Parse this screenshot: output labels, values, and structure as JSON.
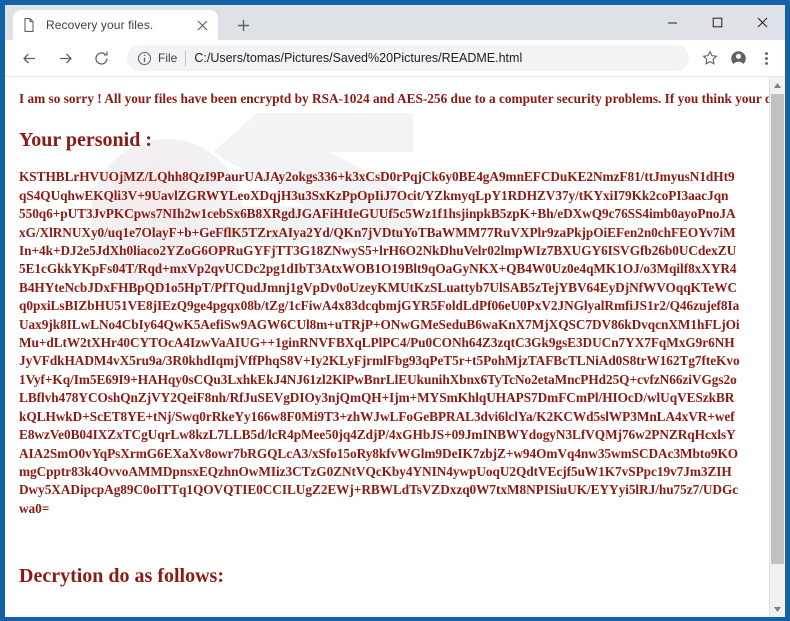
{
  "browser": {
    "tab": {
      "title": "Recovery your files.",
      "favicon_icon": "page-icon",
      "close_icon": "close-icon"
    },
    "new_tab_icon": "plus-icon",
    "window_controls": {
      "minimize_icon": "minimize-icon",
      "maximize_icon": "maximize-icon",
      "close_icon": "close-icon"
    },
    "toolbar": {
      "back_icon": "back-arrow-icon",
      "forward_icon": "forward-arrow-icon",
      "reload_icon": "reload-icon",
      "info_icon": "info-circle-icon",
      "scheme_label": "File",
      "url": "C:/Users/tomas/Pictures/Saved%20Pictures/README.html",
      "bookmark_icon": "star-icon",
      "profile_icon": "account-avatar-icon",
      "menu_icon": "three-dots-menu-icon"
    },
    "scrollbar": {
      "up_arrow_icon": "scroll-up-arrow-icon",
      "down_arrow_icon": "scroll-down-arrow-icon"
    }
  },
  "colors": {
    "window_frame": "#1461a6",
    "tabstrip": "#dee1e6",
    "ransom_text": "#8b1a12",
    "scrollbar_thumb": "#c1c1c1"
  },
  "page": {
    "intro_lines": "I am so sorry ! All your files have been encryptd by RSA-1024 and AES-256 due to a computer security problems.\nIf you think your data is very important .The only way to decrypt your file is to buy my decrytion tool .\nelse you can delete your encrypted data or reinstall your system.",
    "personid_heading": "Your personid :",
    "personid_key": "KSTHBLrHVUOjMZ/LQhh8QzI9PaurUAJAy2okgs336+k3xCsD0rPqjCk6y0BE4gA9mnEFCDuKE2NmzF81/ttJmyusN1dHt9\nqS4QUqhwEKQli3V+9UavlZGRWYLeoXDqjH3u3SxKzPpOpIiJ7Ocit/YZkmyqLpY1RDHZV37y/tKYxiI79Kk2coPI3aacJqn\n550q6+pUT3JvPKCpws7NIh2w1cebSx6B8XRgdJGAFiHtIeGUUf5c5Wz1f1hsjinpkB5zpK+Bh/eDXwQ9c76SS4imb0ayoPnoJA\nxG/XlRNUXy0/uq1e7OlayF+b+GeFflK5TZrxAIya2Yd/QKn7jVDtuYoTBaWMM77RuVXPlr9zaPkjpOiEFen2n0chFEOYv7iM\nIn+4k+DJ2e5JdXh0liaco2YZoG6OPRuGYFjTT3G18ZNwyS5+lrH6O2NkDhuVelr02lmpWIz7BXUGY6ISVGfb26b0UCdexZU\n5E1cGkkYKpFs04T/Rqd+mxVp2qvUCDc2pg1dIbT3AtxWOB1O19Blt9qOaGyNKX+QB4W0Uz0e4qMK1OJ/o3Mqilf8xXYR4\nB4HYteNcbJDxFHBpQD1o5HpT/PfTQudJmnj1gVpDv0oUzeyKMUtKzSLuattyb7UlSAB5zTejYBV64EyDjNfWVOqqKTeWC\nq0pxiLsBIZbHU51VE8jIEzQ9ge4pgqx08b/tZg/1cFiwA4x83dcqbmjGYR5FoldLdPf06eU0PxV2JNGlyalRmfiJS1r2/Q46zujef8Ia\nUax9jk8ILwLNo4CbIy64QwK5AefiSw9AGW6CUl8m+uTRjP+ONwGMeSeduB6waKnX7MjXQSC7DV86kDvqcnXM1hFLjOi\nMu+dLtW2tXHr40CYTOcA4IzwVaAIUG++1ginRNVFBXqLPlPC4/Pu0CONh64Z3zqtC3Gk9gsE3DUCn7YX7FqMxG9r6NH\nJyVFdkHADM4vX5ru9a/3R0khdIqmjVffPhqS8V+Iy2KLyFjrmlFbg93qPeT5r+t5PohMjzTAFBcTLNiAd0S8trW162Tg7fteKvo\n1Vyf+Kq/Im5E69I9+HAHqy0sCQu3LxhkEkJ4NJ61zl2KlPwBnrLlEUkunihXbnx6TyTcNo2etaMncPHd25Q+cvfzN66ziVGgs2o\nLBflvh478YCOshQnZjVY2QeiF8nh/RfJuSEVgDIOy3njQmQH+Ijm+MYSmKhlqUHAPS7DmFCmPl/HIOcD/wlUqVESzkBR\nkQLHwkD+ScET8YE+tNj/Swq0rRkeYy166w8F0Mi9T3+zhWJwLFoGeBPRAL3dvi6lclYa/K2KCWd5slWP3MnLA4xVR+wef\nE8wzVe0B04IXZxTCgUqrLw8kzL7LLB5d/lcR4pMee50jq4ZdjP/4xGHbJS+09JmINBWYdogyN3LfVQMj76w2PNZRqHcxlsY\nAIA2SmO0vYqPsXrmG6EXaXv8owr7bRGQLcA3/xSfo15oRy8kfvWGlm9DeIK7zbjZ+w94OmVq4nw35wmSCDAc3Mbto9KO\nmgCpptr83k4OvvoAMMDpnsxEQzhnOwMIiz3CTzG0ZNtVQcKby4YNIN4ywpUoqU2QdtVEcjf5uW1K7vSPpc19v7Jm3ZIH\nDwy5XADipcpAg89C0oITTq1QOVQTIE0CCILUgZ2EWj+RBWLdTsVZDxzq0W7txM8NPISiuUK/EYYyi5lRJ/hu75z7/UDGc\nwa0=",
    "decryption_heading": "Decrytion do as follows:"
  }
}
